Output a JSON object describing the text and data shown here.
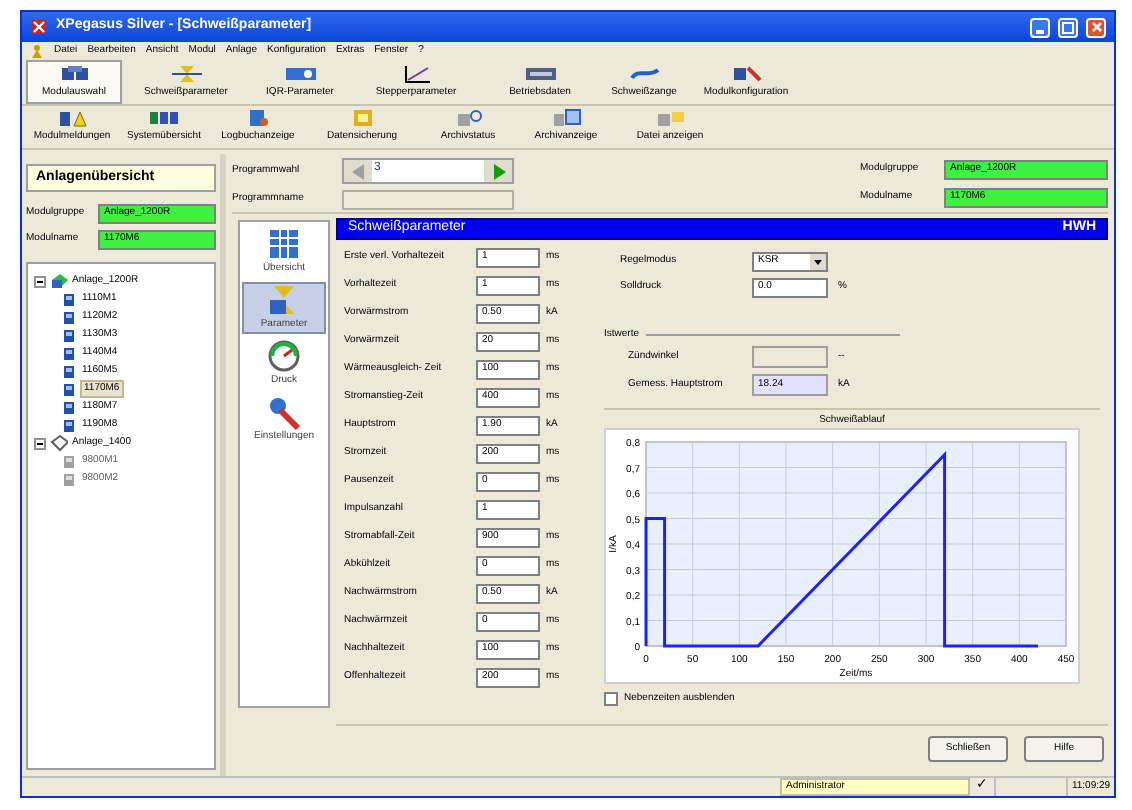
{
  "window": {
    "title": "XPegasus Silver - [Schweißparameter]"
  },
  "menu": [
    "Datei",
    "Bearbeiten",
    "Ansicht",
    "Modul",
    "Anlage",
    "Konfiguration",
    "Extras",
    "Fenster",
    "?"
  ],
  "toolbar_1": [
    {
      "label": "Modulauswahl",
      "selected": true
    },
    {
      "label": "Schweißparameter",
      "selected": false
    },
    {
      "label": "IQR-Parameter",
      "selected": false
    },
    {
      "label": "Stepperparameter",
      "selected": false
    },
    {
      "label": "Betriebsdaten",
      "selected": false
    },
    {
      "label": "Schweißzange",
      "selected": false
    },
    {
      "label": "Modulkonfiguration",
      "selected": false
    }
  ],
  "toolbar_2": [
    "Modulmeldungen",
    "Systemübersicht",
    "Logbuchanzeige",
    "Datensicherung",
    "Archivstatus",
    "Archivanzeige",
    "Datei anzeigen"
  ],
  "left_panel": {
    "title": "Anlagenübersicht",
    "fields": [
      {
        "label": "Modulgruppe",
        "value": "Anlage_1200R"
      },
      {
        "label": "Modulname",
        "value": "1170M6"
      }
    ],
    "tree": [
      {
        "label": "Anlage_1200R",
        "kind": "group",
        "expanded": true,
        "children": [
          {
            "label": "1110M1",
            "selected": false
          },
          {
            "label": "1120M2",
            "selected": false
          },
          {
            "label": "1130M3",
            "selected": false
          },
          {
            "label": "1140M4",
            "selected": false
          },
          {
            "label": "1160M5",
            "selected": false
          },
          {
            "label": "1170M6",
            "selected": true
          },
          {
            "label": "1180M7",
            "selected": false
          },
          {
            "label": "1190M8",
            "selected": false
          }
        ]
      },
      {
        "label": "Anlage_1400",
        "kind": "offline",
        "expanded": true,
        "children": [
          {
            "label": "9800M1",
            "selected": false
          },
          {
            "label": "9800M2",
            "selected": false
          }
        ]
      }
    ]
  },
  "program": {
    "select_label": "Programmwahl",
    "value": "3",
    "name_label": "Programmname"
  },
  "module_info": [
    {
      "label": "Modulgruppe",
      "value": "Anlage_1200R"
    },
    {
      "label": "Modulname",
      "value": "1170M6"
    }
  ],
  "side_nav": [
    {
      "label": "Übersicht",
      "selected": false
    },
    {
      "label": "Parameter",
      "selected": true
    },
    {
      "label": "Druck",
      "selected": false
    },
    {
      "label": "Einstellungen",
      "selected": false
    }
  ],
  "panel": {
    "title": "Schweißparameter",
    "badge": "HWH"
  },
  "parameters": [
    {
      "label": "Erste verl. Vorhaltezeit",
      "value": "1",
      "unit": "ms"
    },
    {
      "label": "Vorhaltezeit",
      "value": "1",
      "unit": "ms"
    },
    {
      "label": "Vorwärmstrom",
      "value": "0.50",
      "unit": "kA"
    },
    {
      "label": "Vorwärmzeit",
      "value": "20",
      "unit": "ms"
    },
    {
      "label": "Wärmeausgleich- Zeit",
      "value": "100",
      "unit": "ms"
    },
    {
      "label": "Stromanstieg-Zeit",
      "value": "400",
      "unit": "ms"
    },
    {
      "label": "Hauptstrom",
      "value": "1.90",
      "unit": "kA"
    },
    {
      "label": "Stromzeit",
      "value": "200",
      "unit": "ms"
    },
    {
      "label": "Pausenzeit",
      "value": "0",
      "unit": "ms"
    },
    {
      "label": "Impulsanzahl",
      "value": "1"
    },
    {
      "label": "Stromabfall-Zeit",
      "value": "900",
      "unit": "ms"
    },
    {
      "label": "Abkühlzeit",
      "value": "0",
      "unit": "ms"
    },
    {
      "label": "Nachwärmstrom",
      "value": "0.50",
      "unit": "kA"
    },
    {
      "label": "Nachwärmzeit",
      "value": "0",
      "unit": "ms"
    },
    {
      "label": "Nachhaltezeit",
      "value": "100",
      "unit": "ms"
    },
    {
      "label": "Offenhaltezeit",
      "value": "200",
      "unit": "ms"
    }
  ],
  "control": {
    "mode_label": "Regelmodus",
    "mode_value": "KSR",
    "pressure_label": "Solldruck",
    "pressure_value": "0.0",
    "pressure_unit": "%"
  },
  "actual_values": {
    "title": "Istwerte",
    "rows": [
      {
        "label": "Zündwinkel",
        "value": "",
        "unit": "--",
        "disabled": true
      },
      {
        "label": "Gemess. Hauptstrom",
        "value": "18.24",
        "unit": "kA",
        "disabled": false
      }
    ]
  },
  "chart": {
    "chart_data": {
      "type": "line",
      "title": "Schweißablauf",
      "xlabel": "Zeit/ms",
      "ylabel": "I/kA",
      "x": [
        0,
        0,
        20,
        20,
        120,
        320,
        320,
        420
      ],
      "series": [
        {
          "color": "#2020ff",
          "values": [
            0,
            0.5,
            0.5,
            0,
            0,
            0.75,
            0,
            0
          ]
        }
      ],
      "grid": true,
      "xlim": [
        0,
        450
      ],
      "ylim": [
        0,
        0.8
      ],
      "xticks": [
        0,
        50,
        100,
        150,
        200,
        250,
        300,
        350,
        400,
        450
      ],
      "yticks": [
        {
          "value": 0,
          "label": "0"
        },
        {
          "value": 0.1,
          "label": "0,1"
        },
        {
          "value": 0.2,
          "label": "0,2"
        },
        {
          "value": 0.3,
          "label": "0,3"
        },
        {
          "value": 0.4,
          "label": "0,4"
        },
        {
          "value": 0.5,
          "label": "0,5"
        },
        {
          "value": 0.6,
          "label": "0,6"
        },
        {
          "value": 0.7,
          "label": "0,7"
        },
        {
          "value": 0.8,
          "label": "0,8"
        }
      ]
    }
  },
  "hide_idle_times": {
    "label": "Nebenzeiten ausblenden",
    "checked": false
  },
  "buttons": [
    "Schließen",
    "Hilfe"
  ],
  "status_bar": {
    "user": "Administrator",
    "check": "✓",
    "time": "11:09:29"
  }
}
